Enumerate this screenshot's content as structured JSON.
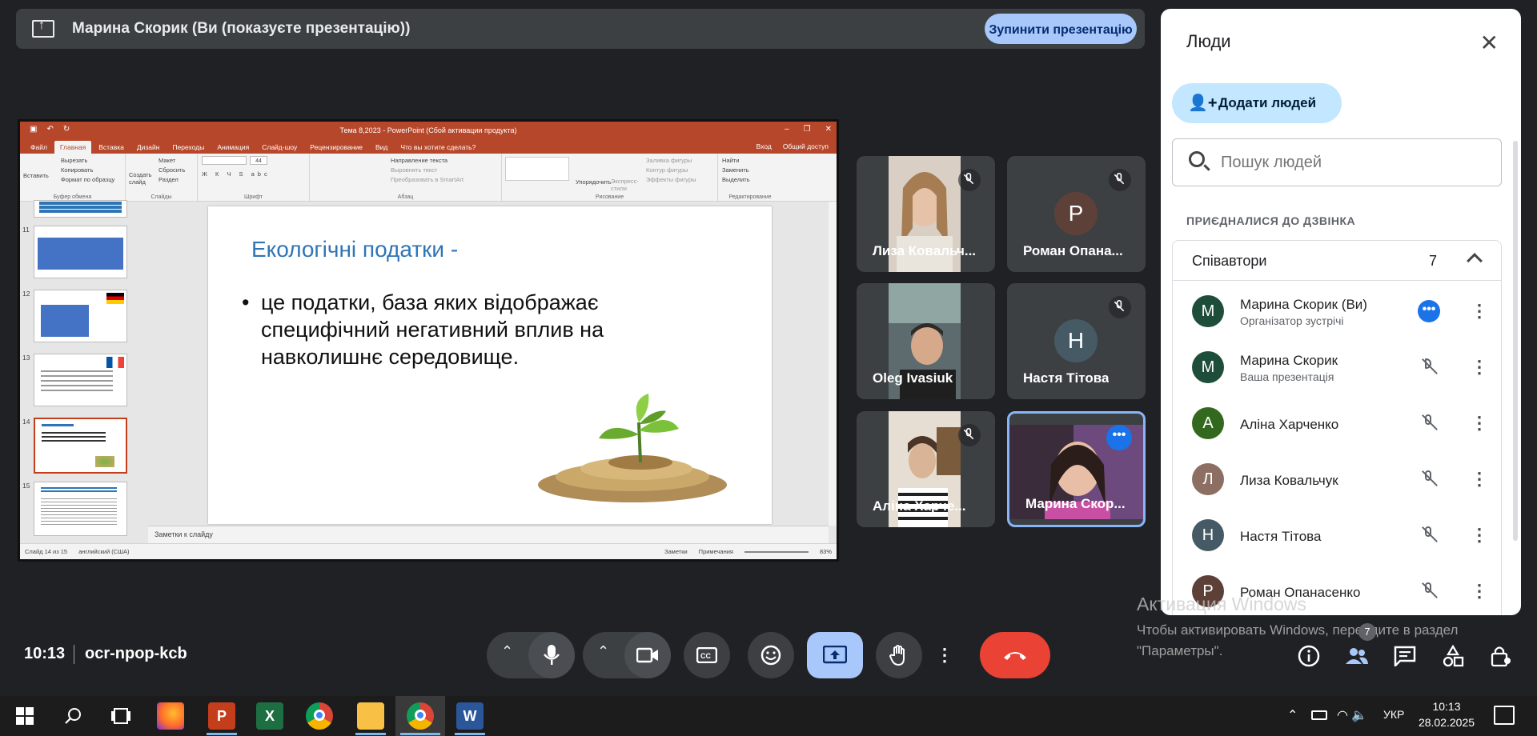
{
  "banner": {
    "title": "Марина Скорик (Ви (показуєте презентацію))",
    "stop_label": "Зупинити презентацію"
  },
  "ppt": {
    "window_title": "Тема 8,2023 - PowerPoint (Сбой активации продукта)",
    "tabs": [
      "Файл",
      "Главная",
      "Вставка",
      "Дизайн",
      "Переходы",
      "Анимация",
      "Слайд-шоу",
      "Рецензирование",
      "Вид"
    ],
    "tell_me": "Что вы хотите сделать?",
    "signin": "Вход",
    "share": "Общий доступ",
    "ribbon": {
      "paste": "Вставить",
      "cut": "Вырезать",
      "copy": "Копировать",
      "format_painter": "Формат по образцу",
      "clipboard_group": "Буфер обмена",
      "new_slide": "Создать слайд",
      "layout": "Макет",
      "reset": "Сбросить",
      "section": "Раздел",
      "slides_group": "Слайды",
      "font_size": "44",
      "font_group": "Шрифт",
      "text_dir": "Направление текста",
      "align_text": "Выровнять текст",
      "smartart": "Преобразовать в SmartArt",
      "paragraph_group": "Абзац",
      "arrange": "Упорядочить",
      "quick_styles": "Экспресс-стили",
      "fill": "Заливка фигуры",
      "outline": "Контур фигуры",
      "effects": "Эффекты фигуры",
      "drawing_group": "Рисование",
      "find": "Найти",
      "replace": "Заменить",
      "select": "Выделить",
      "editing_group": "Редактирование"
    },
    "thumbnails": [
      {
        "num": "11"
      },
      {
        "num": "12"
      },
      {
        "num": "13"
      },
      {
        "num": "14"
      },
      {
        "num": "15"
      }
    ],
    "slide": {
      "title": "Екологічні податки -",
      "bullet": "•",
      "body": "це податки, база яких відображає специфічний негативний вплив на навколишнє середовище."
    },
    "notes": "Заметки к слайду",
    "status": {
      "slide": "Слайд 14 из 15",
      "lang": "английский (США)",
      "notes": "Заметки",
      "comments": "Примечания",
      "zoom": "83%"
    }
  },
  "tiles": [
    {
      "name": "Лиза Ковальч...",
      "muted": true
    },
    {
      "name": "Роман Опана...",
      "avatar": "Р",
      "muted": true,
      "color": "#5d4037"
    },
    {
      "name": "Oleg Ivasiuk",
      "muted": false
    },
    {
      "name": "Настя Тітова",
      "avatar": "Н",
      "muted": true,
      "color": "#455a64"
    },
    {
      "name": "Аліна Харче...",
      "muted": true
    },
    {
      "name": "Марина Скор...",
      "active": true
    }
  ],
  "people": {
    "title": "Люди",
    "add_label": "Додати людей",
    "search_placeholder": "Пошук людей",
    "section": "ПРИЄДНАЛИСЯ ДО ДЗВІНКА",
    "group_label": "Співавтори",
    "group_count": "7",
    "list": [
      {
        "initial": "М",
        "name": "Марина Скорик (Ви)",
        "sub": "Організатор зустрічі",
        "color": "#1e4d3a"
      },
      {
        "initial": "М",
        "name": "Марина Скорик",
        "sub": "Ваша презентація",
        "color": "#1e4d3a"
      },
      {
        "initial": "А",
        "name": "Аліна Харченко",
        "sub": "",
        "color": "#33691e"
      },
      {
        "initial": "Л",
        "name": "Лиза Ковальчук",
        "sub": "",
        "color": "#8d6e63"
      },
      {
        "initial": "Н",
        "name": "Настя Тітова",
        "sub": "",
        "color": "#455a64"
      },
      {
        "initial": "Р",
        "name": "Роман Опанасенко",
        "sub": "",
        "color": "#5d4037"
      }
    ]
  },
  "watermark": {
    "line1": "Активация Windows",
    "line2": "Чтобы активировать Windows, перейдите в раздел",
    "line3": "\"Параметры\"."
  },
  "bottom": {
    "time": "10:13",
    "code": "ocr-npop-kcb",
    "people_badge": "7"
  },
  "taskbar": {
    "lang": "УКР",
    "time": "10:13",
    "date": "28.02.2025"
  },
  "colors": {
    "accent": "#a8c7fa",
    "end_call": "#ea4335",
    "ppt_brand": "#b7472a"
  }
}
